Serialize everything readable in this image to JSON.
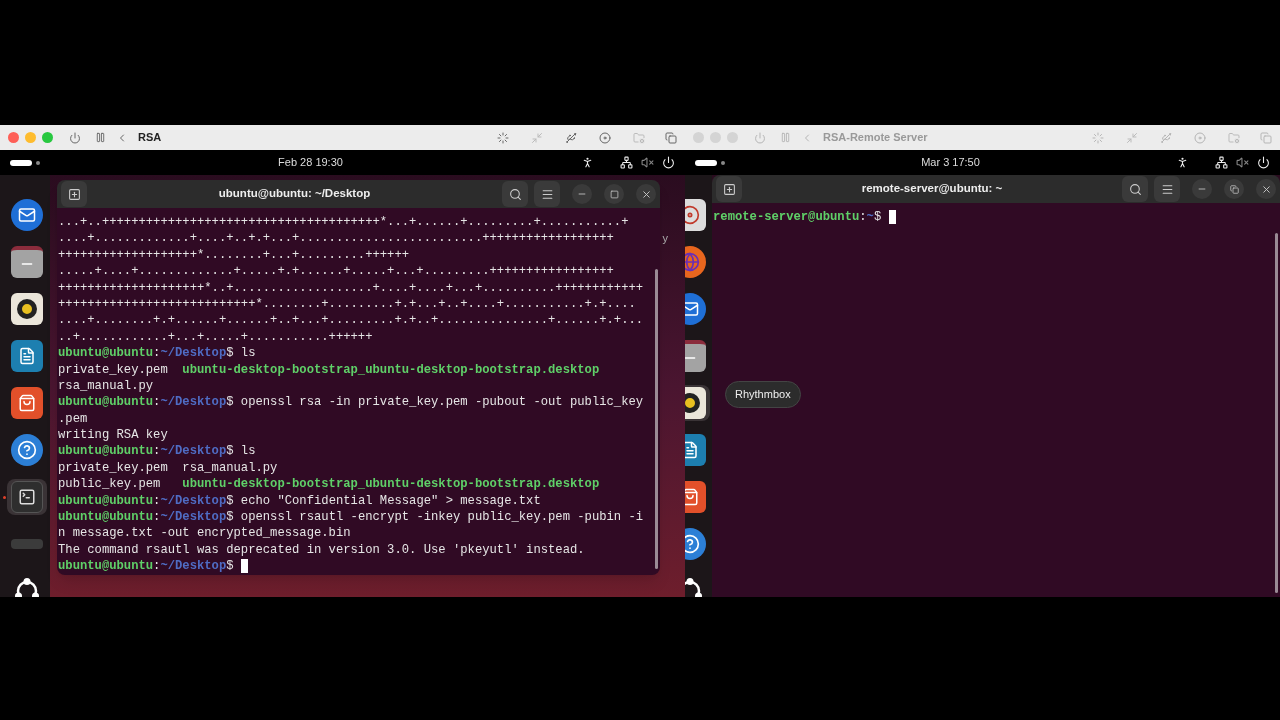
{
  "windows": [
    {
      "title": "RSA",
      "active": true,
      "top_bar": {
        "datetime": "Feb 28  19:30"
      },
      "background_fragment": "y",
      "dock": {
        "items": [
          {
            "kind": "mail",
            "running": false
          },
          {
            "kind": "folder",
            "running": false
          },
          {
            "kind": "speaker",
            "running": false
          },
          {
            "kind": "document",
            "running": false
          },
          {
            "kind": "store",
            "running": false
          },
          {
            "kind": "help",
            "running": false
          },
          {
            "kind": "terminal",
            "running": true
          },
          {
            "kind": "drive",
            "running": false
          },
          {
            "kind": "apps",
            "running": false
          }
        ]
      },
      "terminal": {
        "title": "ubuntu@ubuntu: ~/Desktop",
        "maximized": false,
        "lines": [
          {
            "segments": [
              {
                "kind": "plain",
                "text": "...+..++++++++++++++++++++++++++++++++++++++*...+......+.........+...........+"
              }
            ]
          },
          {
            "segments": [
              {
                "kind": "plain",
                "text": "....+.............+....+..+.+...+.........................++++++++++++++++++"
              }
            ]
          },
          {
            "segments": [
              {
                "kind": "plain",
                "text": "+++++++++++++++++++*........+...+.........++++++"
              }
            ]
          },
          {
            "segments": [
              {
                "kind": "plain",
                "text": ".....+....+.............+.....+.+......+.....+...+.........+++++++++++++++++"
              }
            ]
          },
          {
            "segments": [
              {
                "kind": "plain",
                "text": "++++++++++++++++++++*..+...................+....+....+...+..........++++++++++++"
              }
            ]
          },
          {
            "segments": [
              {
                "kind": "plain",
                "text": "+++++++++++++++++++++++++++*........+.........+.+...+..+....+...........+.+...."
              }
            ]
          },
          {
            "segments": [
              {
                "kind": "plain",
                "text": "....+........+.+......+......+..+...+.........+.+..+...............+......+.+..."
              }
            ]
          },
          {
            "segments": [
              {
                "kind": "plain",
                "text": "..+............+...+.....+...........++++++"
              }
            ]
          },
          {
            "segments": [
              {
                "kind": "user",
                "text": "ubuntu@ubuntu"
              },
              {
                "kind": "plain",
                "text": ":"
              },
              {
                "kind": "path",
                "text": "~/Desktop"
              },
              {
                "kind": "plain",
                "text": "$ ls"
              }
            ]
          },
          {
            "segments": [
              {
                "kind": "plain",
                "text": "private_key.pem  "
              },
              {
                "kind": "exec",
                "text": "ubuntu-desktop-bootstrap_ubuntu-desktop-bootstrap.desktop"
              }
            ]
          },
          {
            "segments": [
              {
                "kind": "plain",
                "text": "rsa_manual.py"
              }
            ]
          },
          {
            "segments": [
              {
                "kind": "user",
                "text": "ubuntu@ubuntu"
              },
              {
                "kind": "plain",
                "text": ":"
              },
              {
                "kind": "path",
                "text": "~/Desktop"
              },
              {
                "kind": "plain",
                "text": "$ openssl rsa -in private_key.pem -pubout -out public_key"
              }
            ]
          },
          {
            "segments": [
              {
                "kind": "plain",
                "text": ".pem"
              }
            ]
          },
          {
            "segments": [
              {
                "kind": "plain",
                "text": "writing RSA key"
              }
            ]
          },
          {
            "segments": [
              {
                "kind": "user",
                "text": "ubuntu@ubuntu"
              },
              {
                "kind": "plain",
                "text": ":"
              },
              {
                "kind": "path",
                "text": "~/Desktop"
              },
              {
                "kind": "plain",
                "text": "$ ls"
              }
            ]
          },
          {
            "segments": [
              {
                "kind": "plain",
                "text": "private_key.pem  rsa_manual.py"
              }
            ]
          },
          {
            "segments": [
              {
                "kind": "plain",
                "text": "public_key.pem   "
              },
              {
                "kind": "exec",
                "text": "ubuntu-desktop-bootstrap_ubuntu-desktop-bootstrap.desktop"
              }
            ]
          },
          {
            "segments": [
              {
                "kind": "user",
                "text": "ubuntu@ubuntu"
              },
              {
                "kind": "plain",
                "text": ":"
              },
              {
                "kind": "path",
                "text": "~/Desktop"
              },
              {
                "kind": "plain",
                "text": "$ echo \"Confidential Message\" > message.txt"
              }
            ]
          },
          {
            "segments": [
              {
                "kind": "user",
                "text": "ubuntu@ubuntu"
              },
              {
                "kind": "plain",
                "text": ":"
              },
              {
                "kind": "path",
                "text": "~/Desktop"
              },
              {
                "kind": "plain",
                "text": "$ openssl rsautl -encrypt -inkey public_key.pem -pubin -i"
              }
            ]
          },
          {
            "segments": [
              {
                "kind": "plain",
                "text": "n message.txt -out encrypted_message.bin"
              }
            ]
          },
          {
            "segments": [
              {
                "kind": "plain",
                "text": "The command rsautl was deprecated in version 3.0. Use 'pkeyutl' instead."
              }
            ]
          },
          {
            "segments": [
              {
                "kind": "user",
                "text": "ubuntu@ubuntu"
              },
              {
                "kind": "plain",
                "text": ":"
              },
              {
                "kind": "path",
                "text": "~/Desktop"
              },
              {
                "kind": "plain",
                "text": "$ "
              }
            ],
            "cursor": true
          }
        ]
      }
    },
    {
      "title": "RSA-Remote Server",
      "active": false,
      "top_bar": {
        "datetime": "Mar 3  17:50"
      },
      "dock": {
        "tooltip": "Rhythmbox",
        "items": [
          {
            "kind": "disc",
            "hovered": false
          },
          {
            "kind": "browser",
            "hovered": false
          },
          {
            "kind": "mail",
            "hovered": false
          },
          {
            "kind": "folder",
            "hovered": false
          },
          {
            "kind": "speaker",
            "hovered": true
          },
          {
            "kind": "document",
            "hovered": false
          },
          {
            "kind": "store",
            "hovered": false
          },
          {
            "kind": "help",
            "hovered": false
          },
          {
            "kind": "apps",
            "hovered": false
          }
        ]
      },
      "terminal": {
        "title": "remote-server@ubuntu: ~",
        "maximized": true,
        "lines": [
          {
            "segments": [
              {
                "kind": "user",
                "text": "remote-server@ubuntu"
              },
              {
                "kind": "plain",
                "text": ":"
              },
              {
                "kind": "path",
                "text": "~"
              },
              {
                "kind": "plain",
                "text": "$ "
              }
            ],
            "cursor": true
          }
        ]
      }
    }
  ]
}
